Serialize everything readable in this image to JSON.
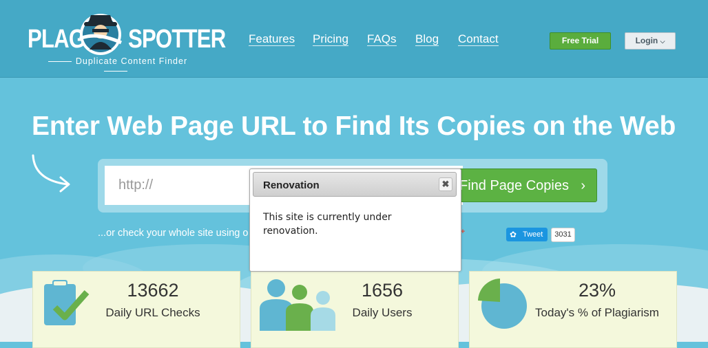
{
  "logo": {
    "left_text": "PLAG",
    "right_text": "SPOTTER",
    "tagline": "Duplicate Content Finder"
  },
  "nav": {
    "items": [
      "Features",
      "Pricing",
      "FAQs",
      "Blog",
      "Contact"
    ],
    "free_trial": "Free Trial",
    "login": "Login"
  },
  "hero": {
    "title": "Enter Web Page URL to Find Its Copies on the Web",
    "url_placeholder": "http://",
    "find_button": "Find Page Copies",
    "subtext": "...or check your whole site using o",
    "gplus": "g+",
    "tweet_label": "Tweet",
    "tweet_count": "3031"
  },
  "stats": [
    {
      "value": "13662",
      "label": "Daily URL Checks",
      "icon": "clipboard-check-icon"
    },
    {
      "value": "1656",
      "label": "Daily Users",
      "icon": "users-icon"
    },
    {
      "value": "23%",
      "label": "Today's % of Plagiarism",
      "icon": "pie-chart-icon"
    }
  ],
  "modal": {
    "title": "Renovation",
    "close": "✖",
    "message": "This site is currently under renovation."
  },
  "colors": {
    "header_bg": "#45a9c6",
    "hero_bg": "#64c2dc",
    "accent_green": "#5cb243",
    "card_bg": "#f4f8dc"
  }
}
